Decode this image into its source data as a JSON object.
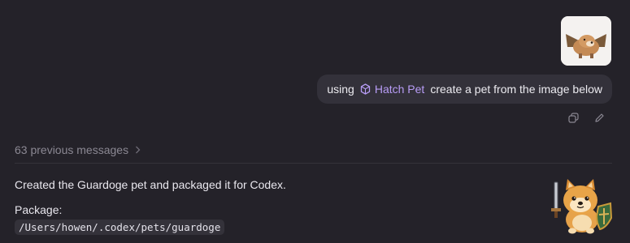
{
  "user_message": {
    "attachment_alt": "attached dog image",
    "prefix": "using",
    "skill_name": "Hatch Pet",
    "suffix": "create a pet from the image below",
    "actions": [
      {
        "icon": "copy-icon"
      },
      {
        "icon": "edit-icon"
      }
    ]
  },
  "history": {
    "previous_label": "63 previous messages"
  },
  "assistant": {
    "summary": "Created the Guardoge pet and packaged it for Codex.",
    "package_label": "Package:",
    "package_path": "/Users/howen/.codex/pets/guardoge",
    "pet_icon": "guardoge-pet-icon"
  },
  "colors": {
    "background": "#242229",
    "bubble": "#33313a",
    "skill_accent": "#b79cf5",
    "muted_text": "#8b8893"
  }
}
